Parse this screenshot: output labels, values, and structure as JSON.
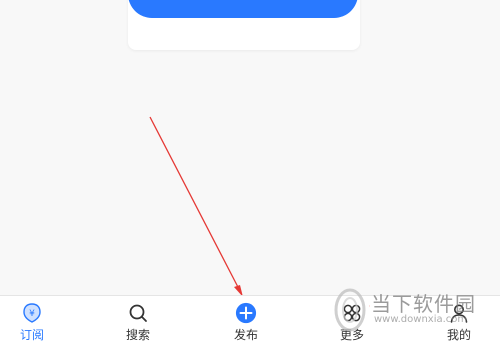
{
  "colors": {
    "accent": "#2979ff",
    "annotation_arrow": "#e53935"
  },
  "card": {
    "button_label": ""
  },
  "tabbar": {
    "tabs": [
      {
        "label": "订阅",
        "icon": "subscribe-icon",
        "active": true
      },
      {
        "label": "搜索",
        "icon": "search-icon",
        "active": false
      },
      {
        "label": "发布",
        "icon": "plus-icon",
        "active": false
      },
      {
        "label": "更多",
        "icon": "grid-more-icon",
        "active": false
      },
      {
        "label": "我的",
        "icon": "person-icon",
        "active": false
      }
    ]
  },
  "watermark": {
    "name": "当下软件园",
    "url": "www.downxia.com"
  }
}
